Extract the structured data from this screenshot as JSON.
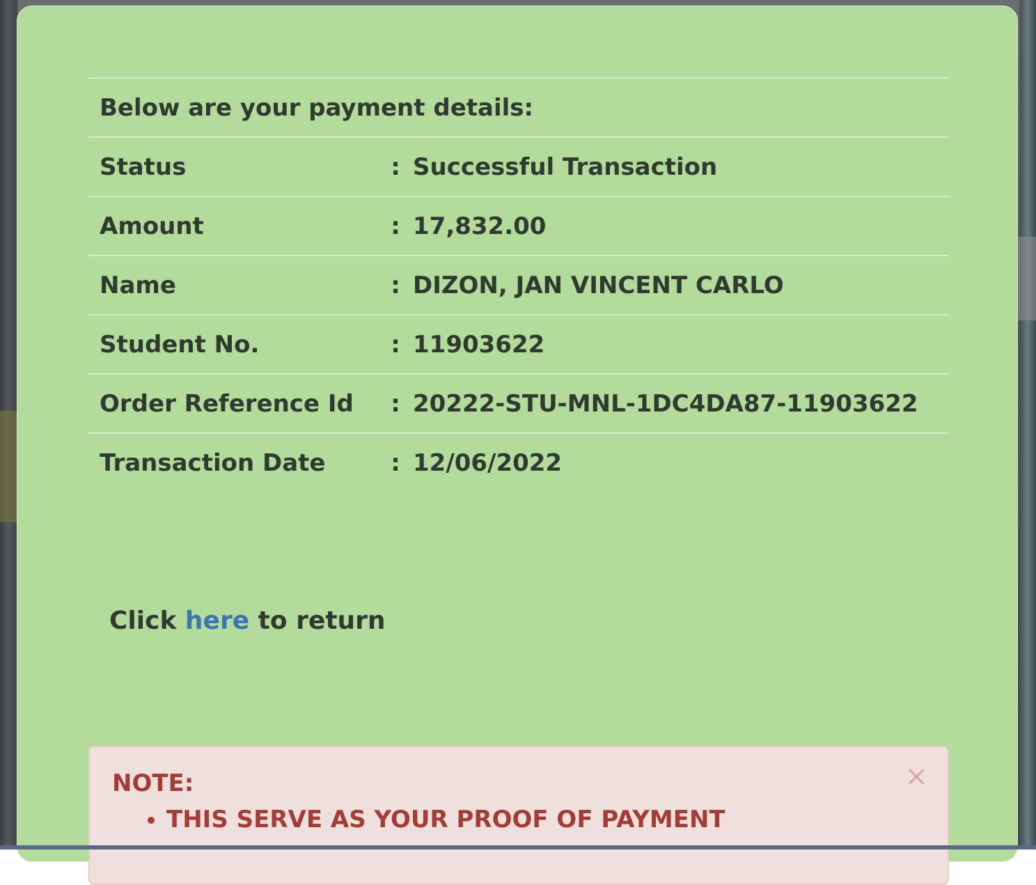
{
  "intro": "Below are your payment details:",
  "separator": ":",
  "rows": [
    {
      "label": "Status",
      "value": "Successful Transaction"
    },
    {
      "label": "Amount",
      "value": "17,832.00"
    },
    {
      "label": "Name",
      "value": "DIZON, JAN VINCENT CARLO"
    },
    {
      "label": "Student No.",
      "value": "11903622"
    },
    {
      "label": "Order Reference Id",
      "value": "20222-STU-MNL-1DC4DA87-11903622"
    },
    {
      "label": "Transaction Date",
      "value": "12/06/2022"
    }
  ],
  "return_line": {
    "before": "Click ",
    "link": "here",
    "after": " to return"
  },
  "note": {
    "title": "NOTE:",
    "items": [
      "THIS SERVE AS YOUR PROOF OF PAYMENT"
    ],
    "close_glyph": "×"
  },
  "colors": {
    "panel_bg": "#b3db9b",
    "link": "#3f74b4",
    "note_bg": "#efdfdd",
    "note_text": "#a33d37"
  }
}
